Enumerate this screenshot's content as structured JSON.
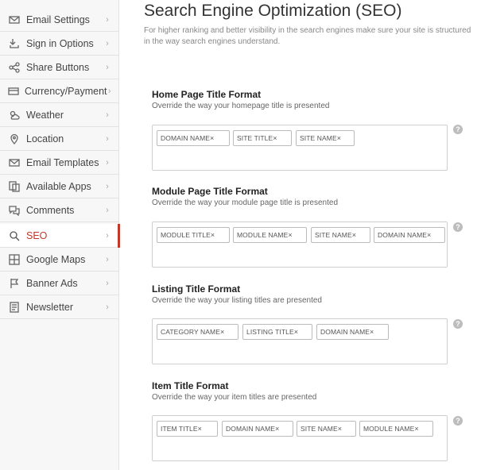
{
  "sidebar": {
    "items": [
      {
        "label": "Email Settings",
        "icon": "envelope-icon"
      },
      {
        "label": "Sign in Options",
        "icon": "sign-in-icon"
      },
      {
        "label": "Share Buttons",
        "icon": "share-icon"
      },
      {
        "label": "Currency/Payment",
        "icon": "card-icon"
      },
      {
        "label": "Weather",
        "icon": "cloud-sun-icon"
      },
      {
        "label": "Location",
        "icon": "map-pin-icon"
      },
      {
        "label": "Email Templates",
        "icon": "envelope-icon"
      },
      {
        "label": "Available Apps",
        "icon": "apps-icon"
      },
      {
        "label": "Comments",
        "icon": "comments-icon"
      },
      {
        "label": "SEO",
        "icon": "search-icon",
        "active": true
      },
      {
        "label": "Google Maps",
        "icon": "globe-icon"
      },
      {
        "label": "Banner Ads",
        "icon": "flag-icon"
      },
      {
        "label": "Newsletter",
        "icon": "newsletter-icon"
      }
    ],
    "chevron": "›"
  },
  "main": {
    "title": "Search Engine Optimization (SEO)",
    "description": "For higher ranking and better visibility in the search engines make sure your site is structured in the way search engines understand.",
    "help_glyph": "?",
    "remove_glyph": "×",
    "sections": [
      {
        "title": "Home Page Title Format",
        "desc": "Override the way your homepage title is presented",
        "tokens": [
          "DOMAIN NAME",
          "SITE TITLE",
          "SITE NAME"
        ]
      },
      {
        "title": "Module Page Title Format",
        "desc": "Override the way your module page title is presented",
        "tokens": [
          "MODULE TITLE",
          "MODULE NAME",
          "SITE NAME",
          "DOMAIN NAME"
        ]
      },
      {
        "title": "Listing Title Format",
        "desc": "Override the way your listing titles are presented",
        "tokens": [
          "CATEGORY NAME",
          "LISTING TITLE",
          "DOMAIN NAME"
        ]
      },
      {
        "title": "Item Title Format",
        "desc": "Override the way your item titles are presented",
        "tokens": [
          "ITEM TITLE",
          "DOMAIN NAME",
          "SITE NAME",
          "MODULE NAME"
        ]
      }
    ]
  },
  "colors": {
    "accent": "#c0392b",
    "sidebar_bg": "#f7f7f7",
    "border": "#cfcfcf"
  }
}
